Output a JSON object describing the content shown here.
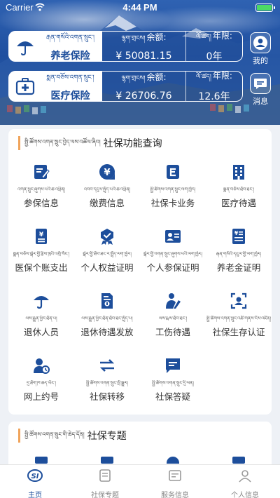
{
  "status_bar": {
    "carrier": "Carrier",
    "time": "4:44 PM"
  },
  "colors": {
    "primary": "#1d4e9b",
    "accent": "#f0a35a",
    "battery": "#4cd964"
  },
  "cards": [
    {
      "icon": "umbrella-icon",
      "name_tibetan": "རྒན་གསོའི་འགན་སྲུང་།",
      "name": "养老保险",
      "amount_label_tibetan": "ལྷག་གྲངས།",
      "amount_label": "余额:",
      "amount": "¥ 50081.15",
      "years_label_tibetan": "ལོ་ཚད།",
      "years_label": "年限:",
      "years": "0年"
    },
    {
      "icon": "medical-kit-icon",
      "name_tibetan": "སྨན་བཅོས་འགན་སྲུང་།",
      "name": "医疗保险",
      "amount_label_tibetan": "ལྷག་གྲངས།",
      "amount_label": "余额:",
      "amount": "¥ 26706.76",
      "years_label_tibetan": "ལོ་ཚད།",
      "years_label": "年限:",
      "years": "12.6年"
    }
  ],
  "side_buttons": {
    "me": "我的",
    "messages": "消息"
  },
  "function_panel": {
    "title_tibetan": "སྤྱི་ཚོགས་འགན་སྲུང་བྱེད་ལས་འཚོལ་ཞིབ།",
    "title": "社保功能查询",
    "items": [
      {
        "icon": "form-edit-icon",
        "tibetan": "འགན་སྲུང་ཞུགས་པའི་ཆ་འཕྲིན།",
        "label": "参保信息"
      },
      {
        "icon": "yen-circle-icon",
        "tibetan": "འབབ་དངུལ་སྤྲོད་པའི་ཆ་འཕྲིན།",
        "label": "缴费信息"
      },
      {
        "icon": "card-e-icon",
        "tibetan": "སྤྱི་ཚོགས་འགན་སྲུང་ལག་ཁྱེར།",
        "label": "社保卡业务"
      },
      {
        "icon": "hospital-building-icon",
        "tibetan": "སྨན་བཅོས་ཐོབ་ཐང་།",
        "label": "医疗待遇"
      },
      {
        "icon": "personal-account-icon",
        "tibetan": "སྨན་བཅོས་སྒེར་གྱི་རྩིས་ཁྲའི་འགྲོ་སོང་།",
        "label": "医保个账支出"
      },
      {
        "icon": "rights-badge-icon",
        "tibetan": "སྒེར་གྱི་ཐོབ་ཐང་ར་སྤྲོད་ལག་ཁྱེར།",
        "label": "个人权益证明"
      },
      {
        "icon": "person-card-icon",
        "tibetan": "སྒེར་གྱི་འགན་སྲུང་ཞུགས་པའི་ལག་ཁྱེར།",
        "label": "个人参保证明"
      },
      {
        "icon": "pension-doc-icon",
        "tibetan": "རྒན་གསོའི་དངུལ་གྱི་ལག་ཁྱེར།",
        "label": "养老金证明"
      },
      {
        "icon": "umbrella-person-icon",
        "tibetan": "ལས་རྒྱུན་ཕྱིར་ཐོན་པ།",
        "label": "退休人员"
      },
      {
        "icon": "retire-document-icon",
        "tibetan": "ལས་རྒྱུན་ཕྱིར་ཐོན་ཐོབ་ཐང་སྤྲོད་པ།",
        "label": "退休待遇发放"
      },
      {
        "icon": "injury-person-icon",
        "tibetan": "ལས་རྨས་ཐོབ་ཐང་།",
        "label": "工伤待遇"
      },
      {
        "icon": "face-verify-icon",
        "tibetan": "སྤྱི་ཚོགས་འགན་སྲུང་འཚོ་གནས་ངོས་འཛིན།",
        "label": "社保生存认证"
      },
      {
        "icon": "user-appointment-icon",
        "tibetan": "དྲ་ཐོག་ཁ་ཆད་ཡོང་།",
        "label": "网上约号"
      },
      {
        "icon": "transfer-arrows-icon",
        "tibetan": "སྤྱི་ཚོགས་འགན་སྲུང་སྤོ་སྒྱུར།",
        "label": "社保转移"
      },
      {
        "icon": "chat-answer-icon",
        "tibetan": "སྤྱི་ཚོགས་འགན་སྲུང་དྲི་ལན།",
        "label": "社保答疑"
      }
    ]
  },
  "topic_panel": {
    "title_tibetan": "སྤྱི་ཚོགས་འགན་སྲུང་གི་ཆེད་དོན།",
    "title": "社保专题"
  },
  "tabbar": [
    {
      "icon": "si-logo-icon",
      "label": "主页",
      "active": true
    },
    {
      "icon": "topic-book-icon",
      "label": "社保专题",
      "active": false
    },
    {
      "icon": "service-info-icon",
      "label": "服务信息",
      "active": false
    },
    {
      "icon": "person-info-icon",
      "label": "个人信息",
      "active": false
    }
  ]
}
